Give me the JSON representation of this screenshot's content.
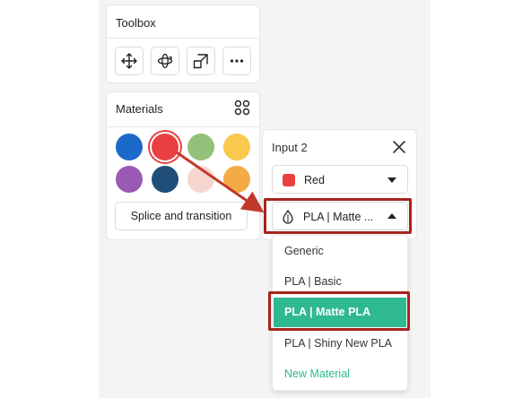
{
  "toolbox": {
    "title": "Toolbox",
    "tools": [
      {
        "icon": "move-icon"
      },
      {
        "icon": "rotate-icon"
      },
      {
        "icon": "scale-icon"
      },
      {
        "icon": "more-icon"
      }
    ]
  },
  "materials": {
    "title": "Materials",
    "grid_icon": "grid-icon",
    "swatches": [
      {
        "color": "#1b6ac9"
      },
      {
        "color": "#e84040",
        "selected": true
      },
      {
        "color": "#94c17a"
      },
      {
        "color": "#f9c84f"
      },
      {
        "color": "#9b59b6"
      },
      {
        "color": "#1f4e79"
      },
      {
        "color": "#f8d6d0"
      },
      {
        "color": "#f4ab45"
      }
    ],
    "splice_label": "Splice and transition"
  },
  "input_panel": {
    "title": "Input 2",
    "color_select": {
      "value": "Red",
      "color": "#e84040"
    },
    "material_select": {
      "value": "PLA | Matte ..."
    },
    "options": [
      {
        "label": "Generic"
      },
      {
        "label": "PLA | Basic"
      },
      {
        "label": "PLA | Matte PLA",
        "selected": true
      },
      {
        "label": "PLA | Shiny New PLA"
      },
      {
        "label": "New Material",
        "accent": true
      }
    ]
  },
  "colors": {
    "accent": "#2fb98e",
    "highlight": "#a8231c",
    "arrow": "#c0392b"
  }
}
